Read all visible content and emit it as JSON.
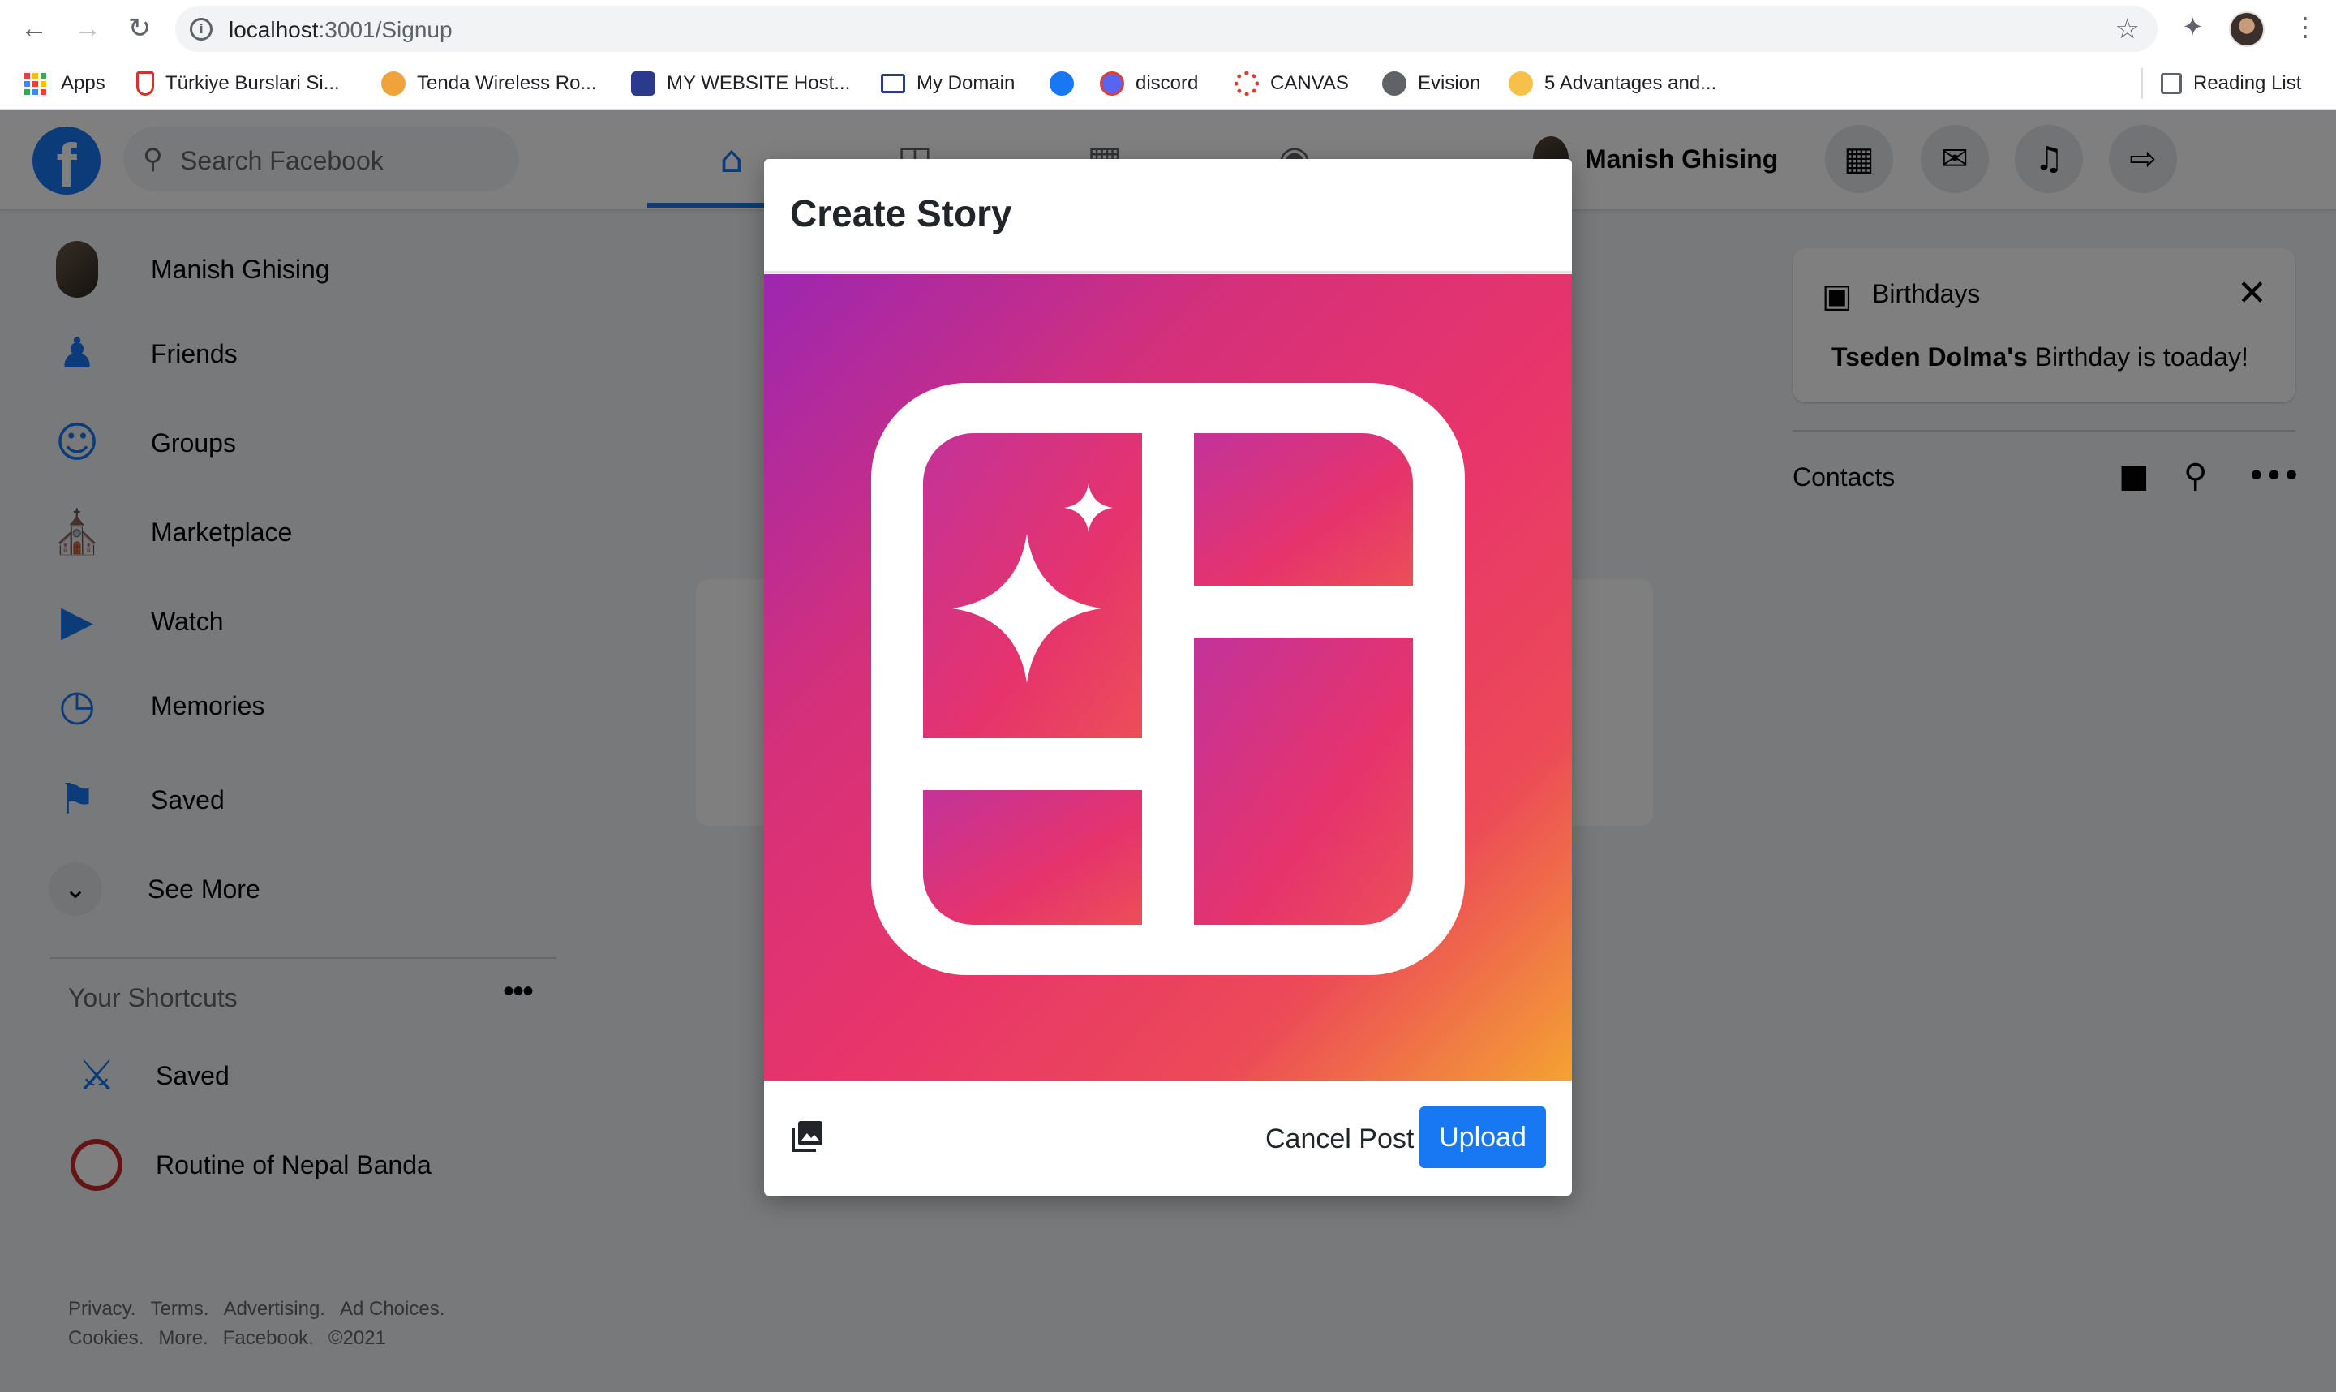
{
  "browser": {
    "url_host": "localhost",
    "url_path": ":3001/Signup",
    "bookmarks": [
      {
        "label": "Apps",
        "icon": "apps-grid-icon"
      },
      {
        "label": "Türkiye Burslari Si...",
        "icon": "turkiye-burslari-icon"
      },
      {
        "label": "Tenda Wireless Ro...",
        "icon": "tenda-icon"
      },
      {
        "label": "MY WEBSITE Host...",
        "icon": "hosting-icon"
      },
      {
        "label": "My Domain",
        "icon": "domain-icon"
      },
      {
        "label": "",
        "icon": "facebook-icon"
      },
      {
        "label": "discord",
        "icon": "discord-icon"
      },
      {
        "label": "CANVAS",
        "icon": "canvas-icon"
      },
      {
        "label": "Evision",
        "icon": "globe-icon"
      },
      {
        "label": "5 Advantages and...",
        "icon": "emoji-icon"
      }
    ],
    "reading_list": "Reading List"
  },
  "header": {
    "search_placeholder": "Search Facebook",
    "user_name": "Manish Ghising"
  },
  "sidebar": {
    "items": [
      {
        "label": "Manish Ghising",
        "icon": "avatar"
      },
      {
        "label": "Friends",
        "icon": "friends-icon"
      },
      {
        "label": "Groups",
        "icon": "groups-icon"
      },
      {
        "label": "Marketplace",
        "icon": "marketplace-icon"
      },
      {
        "label": "Watch",
        "icon": "watch-icon"
      },
      {
        "label": "Memories",
        "icon": "memories-icon"
      },
      {
        "label": "Saved",
        "icon": "bookmark-icon"
      },
      {
        "label": "See More",
        "icon": "chevron-down-icon"
      }
    ],
    "shortcuts_title": "Your Shortcuts",
    "shortcuts": [
      {
        "label": "Saved",
        "icon": "gamepad-icon"
      },
      {
        "label": "Routine of Nepal Banda",
        "icon": "ronb-logo"
      }
    ],
    "footer_links": [
      "Privacy.",
      "Terms.",
      "Advertising.",
      "Ad Choices.",
      "Cookies.",
      "More.",
      "Facebook.",
      "©2021"
    ]
  },
  "birthdays": {
    "title": "Birthdays",
    "name": "Tseden Dolma's",
    "message": " Birthday is toaday!"
  },
  "contacts": {
    "title": "Contacts"
  },
  "modal": {
    "title": "Create Story",
    "cancel_label": "Cancel Post",
    "upload_label": "Upload"
  },
  "colors": {
    "facebook_blue": "#1877f2",
    "overlay": "rgba(0,0,0,0.5)",
    "gradient_start": "#9c27b0",
    "gradient_end": "#f4a233"
  }
}
